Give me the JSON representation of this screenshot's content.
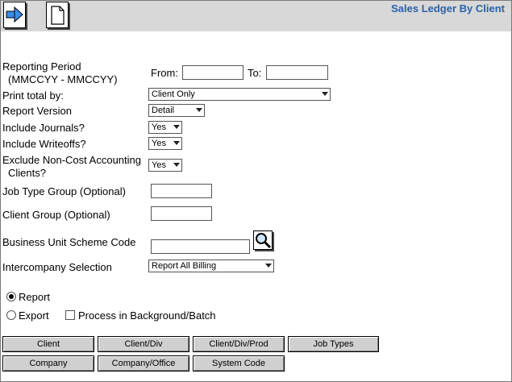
{
  "header": {
    "title": "Sales Ledger By Client",
    "toolbar": {
      "run_icon": "arrow-right-icon",
      "new_icon": "document-icon"
    }
  },
  "form": {
    "reporting_period": {
      "label_line1": "Reporting Period",
      "label_line2": "(MMCCYY - MMCCYY)",
      "from_label": "From:",
      "from_value": "",
      "to_label": "To:",
      "to_value": ""
    },
    "print_total_by": {
      "label": "Print total by:",
      "value": "Client Only"
    },
    "report_version": {
      "label": "Report Version",
      "value": "Detail"
    },
    "include_journals": {
      "label": "Include Journals?",
      "value": "Yes"
    },
    "include_writeoffs": {
      "label": "Include Writeoffs?",
      "value": "Yes"
    },
    "exclude_non_cost": {
      "label_line1": "Exclude Non-Cost Accounting",
      "label_line2": "Clients?",
      "value": "Yes"
    },
    "job_type_group": {
      "label": "Job Type Group (Optional)",
      "value": ""
    },
    "client_group": {
      "label": "Client Group (Optional)",
      "value": ""
    },
    "business_unit": {
      "label": "Business Unit Scheme Code",
      "value": "",
      "lookup_icon": "magnifier-icon"
    },
    "intercompany": {
      "label": "Intercompany Selection",
      "value": "Report All Billing"
    },
    "output": {
      "report_label": "Report",
      "export_label": "Export",
      "selected": "Report",
      "background_label": "Process in Background/Batch",
      "background_checked": false
    }
  },
  "buttons": {
    "client": "Client",
    "client_div": "Client/Div",
    "client_div_prod": "Client/Div/Prod",
    "job_types": "Job Types",
    "company": "Company",
    "company_office": "Company/Office",
    "system_code": "System Code"
  },
  "colors": {
    "title": "#2a62a8",
    "toolbar_bg": "#d8d8d8",
    "button_bg": "#d0d0d0"
  }
}
